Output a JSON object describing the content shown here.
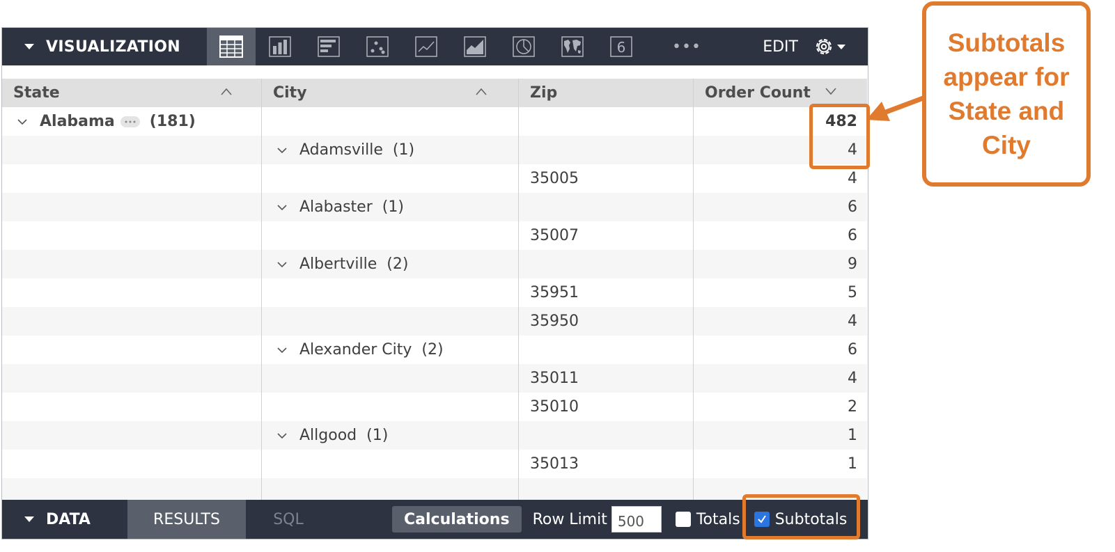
{
  "toolbar": {
    "title": "VISUALIZATION",
    "edit_label": "EDIT",
    "more_label": "•••",
    "viz_types": [
      {
        "name": "table",
        "active": true
      },
      {
        "name": "column",
        "active": false
      },
      {
        "name": "bar",
        "active": false
      },
      {
        "name": "scatter",
        "active": false
      },
      {
        "name": "line",
        "active": false
      },
      {
        "name": "area",
        "active": false
      },
      {
        "name": "pie",
        "active": false
      },
      {
        "name": "map",
        "active": false
      },
      {
        "name": "single-value",
        "active": false,
        "glyph": "6"
      }
    ]
  },
  "table": {
    "columns": [
      {
        "label": "State",
        "sort": "asc"
      },
      {
        "label": "City",
        "sort": "asc"
      },
      {
        "label": "Zip",
        "sort": ""
      },
      {
        "label": "Order Count",
        "sort": "desc"
      }
    ],
    "rows": [
      {
        "kind": "state",
        "state": "Alabama",
        "count": "(181)",
        "zip": "",
        "value": "482"
      },
      {
        "kind": "city",
        "city": "Adamsville",
        "count": "(1)",
        "zip": "",
        "value": "4"
      },
      {
        "kind": "zip",
        "zip": "35005",
        "value": "4"
      },
      {
        "kind": "city",
        "city": "Alabaster",
        "count": "(1)",
        "zip": "",
        "value": "6"
      },
      {
        "kind": "zip",
        "zip": "35007",
        "value": "6"
      },
      {
        "kind": "city",
        "city": "Albertville",
        "count": "(2)",
        "zip": "",
        "value": "9"
      },
      {
        "kind": "zip",
        "zip": "35951",
        "value": "5"
      },
      {
        "kind": "zip",
        "zip": "35950",
        "value": "4"
      },
      {
        "kind": "city",
        "city": "Alexander City",
        "count": "(2)",
        "zip": "",
        "value": "6"
      },
      {
        "kind": "zip",
        "zip": "35011",
        "value": "4"
      },
      {
        "kind": "zip",
        "zip": "35010",
        "value": "2"
      },
      {
        "kind": "city",
        "city": "Allgood",
        "count": "(1)",
        "zip": "",
        "value": "1"
      },
      {
        "kind": "zip",
        "zip": "35013",
        "value": "1"
      }
    ]
  },
  "data_bar": {
    "title": "DATA",
    "tabs": [
      {
        "label": "RESULTS",
        "active": true
      },
      {
        "label": "SQL",
        "active": false
      }
    ],
    "calculations_label": "Calculations",
    "row_limit_label": "Row Limit",
    "row_limit_value": "500",
    "totals": {
      "label": "Totals",
      "checked": false
    },
    "subtotals": {
      "label": "Subtotals",
      "checked": true
    }
  },
  "callout": {
    "text": "Subtotals appear for State and City",
    "color": "#e07a2e"
  },
  "colors": {
    "toolbar_bg": "#2d3340",
    "active_bg": "#5a606b",
    "header_bg": "#e0e0e0",
    "checkbox_checked": "#2b75e1",
    "accent": "#e07a2e"
  }
}
